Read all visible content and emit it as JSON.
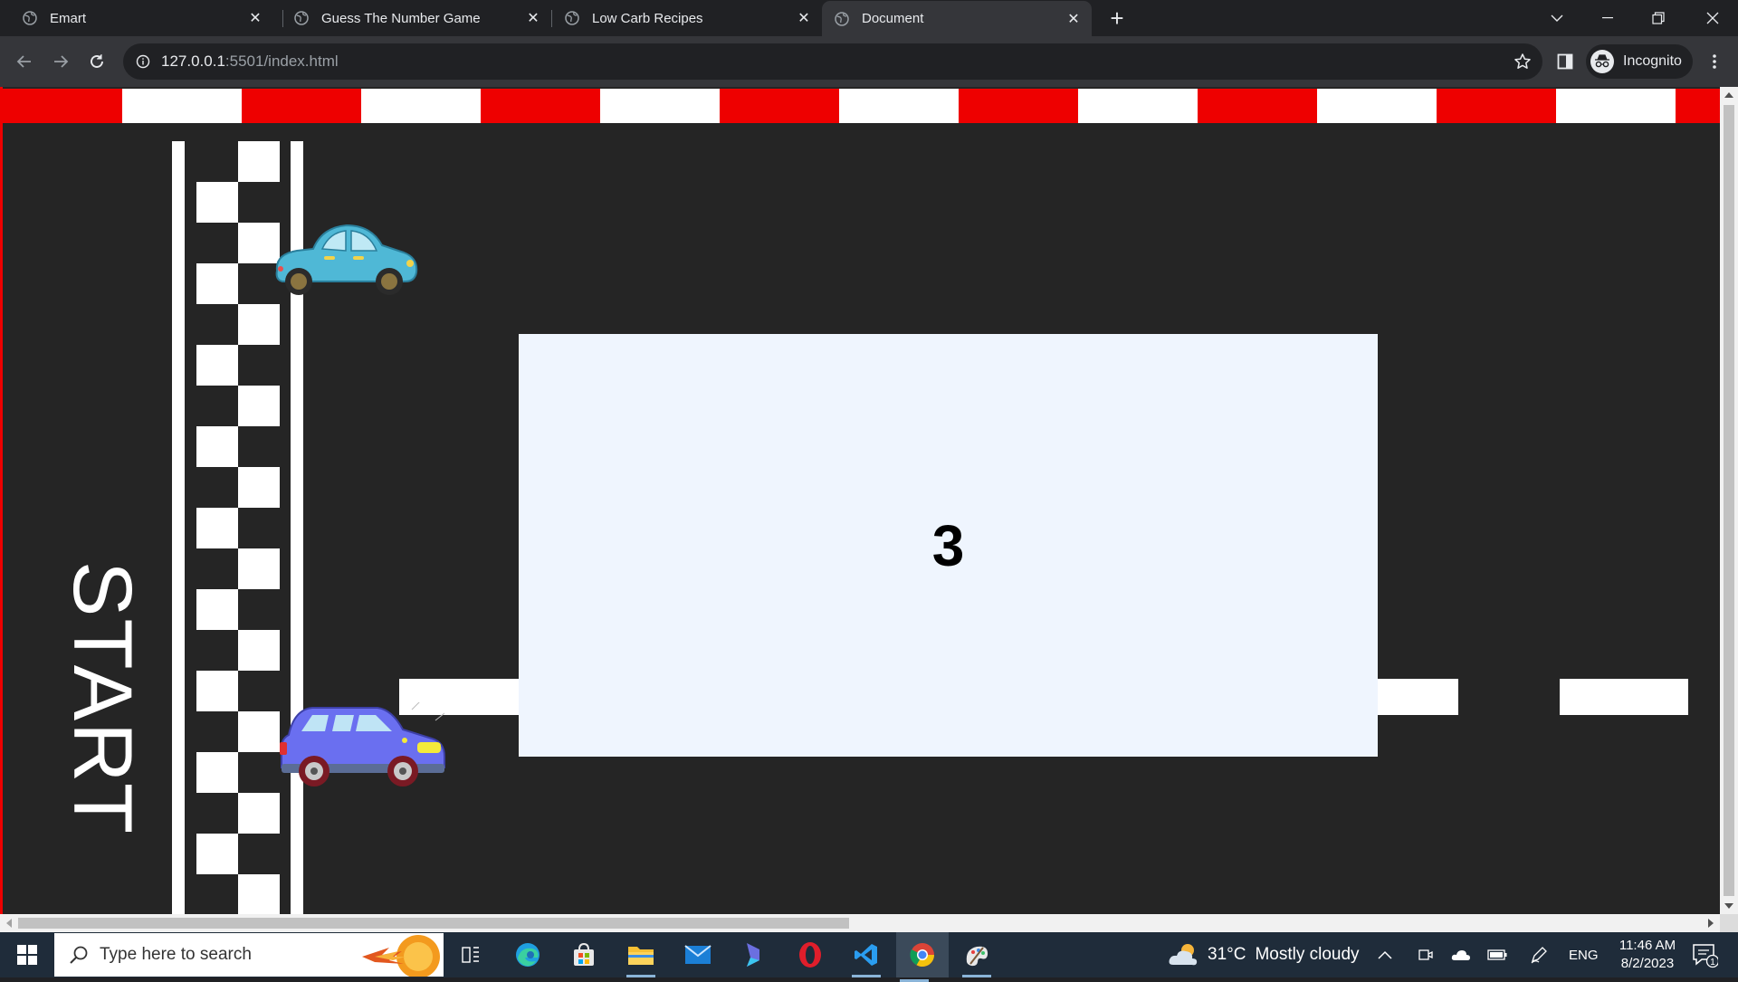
{
  "browser": {
    "tabs": [
      {
        "title": "Emart",
        "active": false
      },
      {
        "title": "Guess The Number Game",
        "active": false
      },
      {
        "title": "Low Carb Recipes",
        "active": false
      },
      {
        "title": "Document",
        "active": true
      }
    ],
    "url_host": "127.0.0.1",
    "url_rest": ":5501/index.html",
    "profile_label": "Incognito"
  },
  "page": {
    "start_label": "START",
    "countdown": "3",
    "colors": {
      "track": "#252525",
      "curb_red": "#ee0000",
      "curb_white": "#ffffff",
      "countdown_bg": "#eff5fe",
      "car1": "#4fb8d6",
      "car2": "#6a6ff0"
    }
  },
  "taskbar": {
    "search_placeholder": "Type here to search",
    "weather_temp": "31°C",
    "weather_desc": "Mostly cloudy",
    "language": "ENG",
    "time": "11:46 AM",
    "date": "8/2/2023",
    "notification_count": "1",
    "pinned_apps": [
      "task-view",
      "edge",
      "microsoft-store",
      "file-explorer",
      "mail",
      "bing",
      "opera",
      "vscode",
      "chrome",
      "paint"
    ]
  }
}
